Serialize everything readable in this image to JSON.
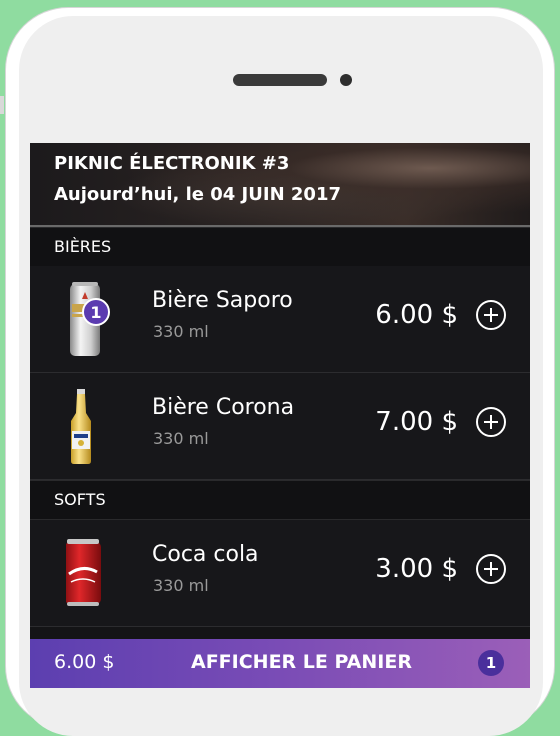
{
  "event": {
    "title": "PIKNIC ÉLECTRONIK #3",
    "date": "Aujourd’hui, le  04 JUIN 2017"
  },
  "sections": [
    {
      "label": "BIÈRES",
      "items": [
        {
          "name": "Bière Saporo",
          "volume": "330 ml",
          "price": "6.00 $",
          "quantity_badge": "1",
          "icon": "beer-can-icon"
        },
        {
          "name": "Bière Corona",
          "volume": "330 ml",
          "price": "7.00 $",
          "icon": "beer-bottle-icon"
        }
      ]
    },
    {
      "label": "SOFTS",
      "items": [
        {
          "name": "Coca cola",
          "volume": "330 ml",
          "price": "3.00 $",
          "icon": "soda-can-icon"
        }
      ]
    }
  ],
  "cart": {
    "total": "6.00 $",
    "label": "AFFICHER LE PANIER",
    "count": "1"
  },
  "colors": {
    "accent": "#5b3bb0",
    "accent_end": "#9b5fb8",
    "background": "#17171a",
    "page_bg": "#8fdca0"
  }
}
